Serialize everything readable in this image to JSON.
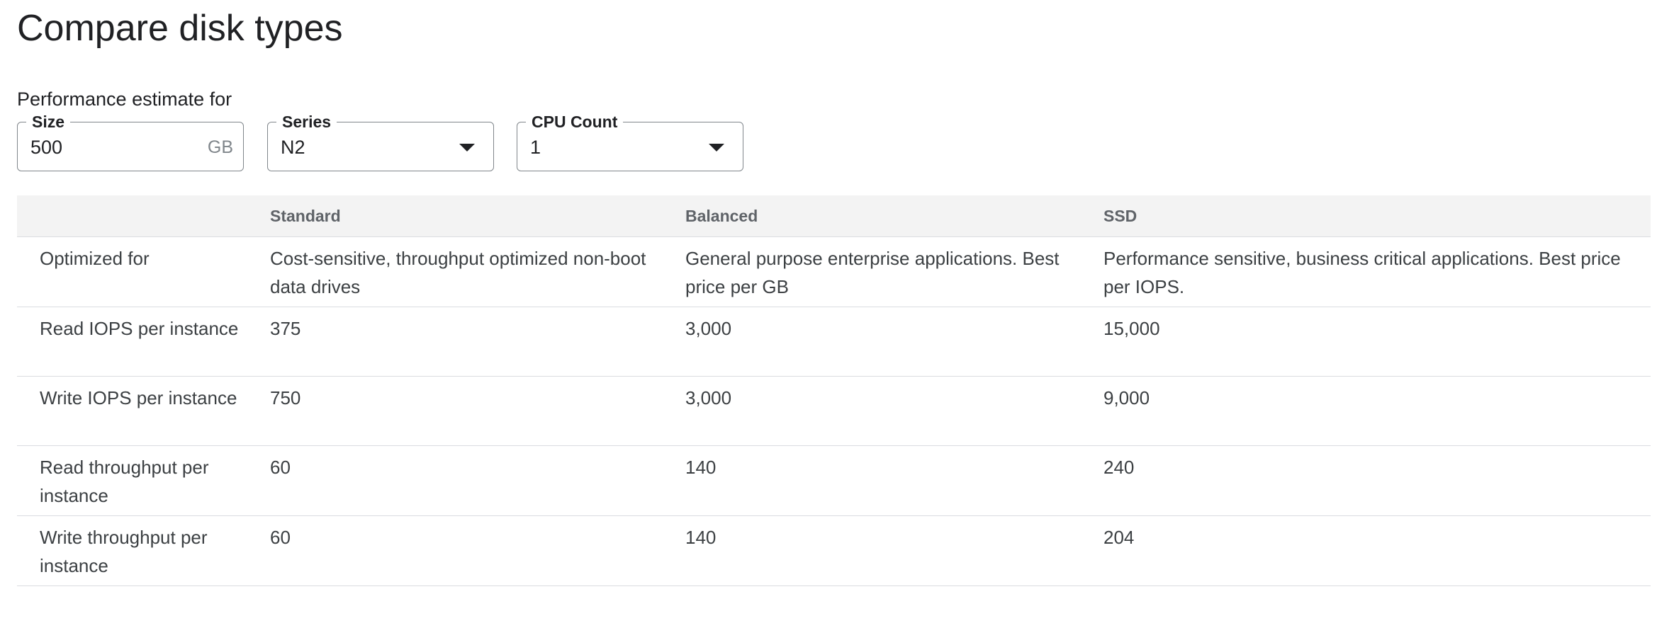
{
  "page": {
    "title": "Compare disk types",
    "estimate_label": "Performance estimate for"
  },
  "controls": {
    "size": {
      "label": "Size",
      "value": "500",
      "suffix": "GB"
    },
    "series": {
      "label": "Series",
      "value": "N2"
    },
    "cpu_count": {
      "label": "CPU Count",
      "value": "1"
    }
  },
  "table": {
    "headers": [
      "",
      "Standard",
      "Balanced",
      "SSD"
    ],
    "rows": [
      {
        "label": "Optimized for",
        "standard": "Cost-sensitive, throughput optimized non-boot data drives",
        "balanced": "General purpose enterprise applications. Best price per GB",
        "ssd": "Performance sensitive, business critical applications. Best price per IOPS."
      },
      {
        "label": "Read IOPS per instance",
        "standard": "375",
        "balanced": "3,000",
        "ssd": "15,000"
      },
      {
        "label": "Write IOPS per instance",
        "standard": "750",
        "balanced": "3,000",
        "ssd": "9,000"
      },
      {
        "label": "Read throughput per instance",
        "standard": "60",
        "balanced": "140",
        "ssd": "240"
      },
      {
        "label": "Write throughput per instance",
        "standard": "60",
        "balanced": "140",
        "ssd": "204"
      }
    ]
  },
  "colors": {
    "text_primary": "#202124",
    "text_secondary": "#3c4043",
    "header_text": "#5f6368",
    "header_bg": "#f3f3f3",
    "border": "#dadce0",
    "field_border": "#80868b"
  }
}
